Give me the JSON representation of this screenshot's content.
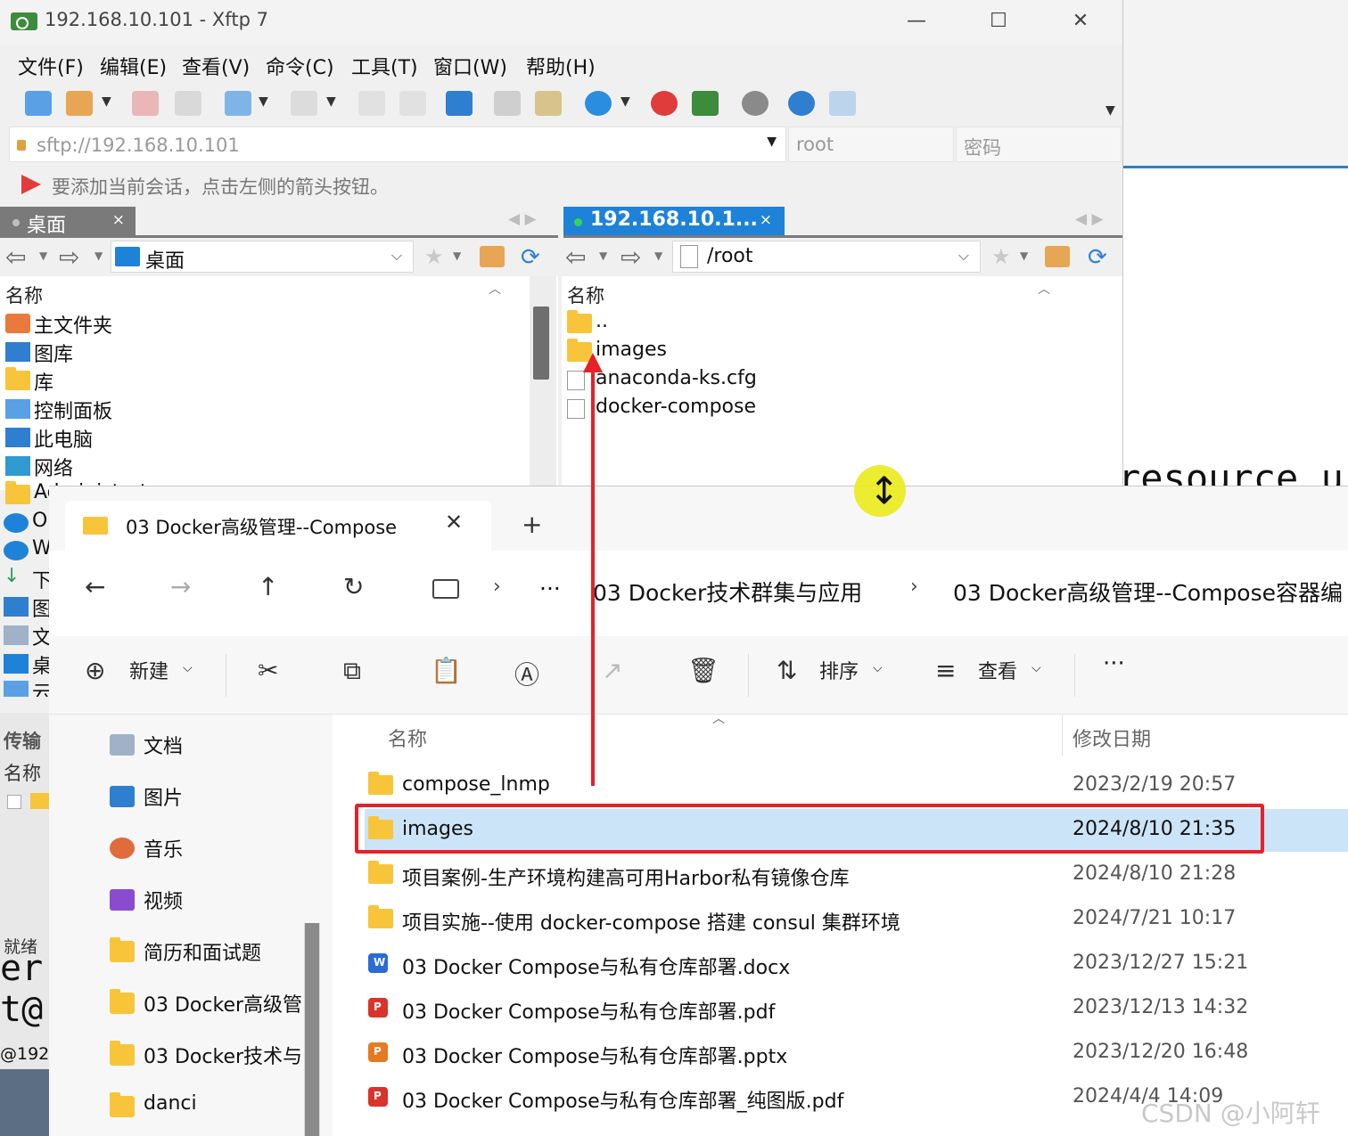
{
  "terminal": {
    "text": "resource u"
  },
  "xftp": {
    "title": "192.168.10.101 - Xftp 7",
    "window_controls": {
      "minimize": "—",
      "maximize": "☐",
      "close": "✕"
    },
    "menu": [
      "文件(F)",
      "编辑(E)",
      "查看(V)",
      "命令(C)",
      "工具(T)",
      "窗口(W)",
      "帮助(H)"
    ],
    "address": {
      "value": "sftp://192.168.10.101",
      "user_placeholder": "root",
      "password_placeholder": "密码"
    },
    "hint": "要添加当前会话，点击左侧的箭头按钮。",
    "local": {
      "tab_label": "桌面",
      "path": "桌面",
      "column_name": "名称",
      "items": [
        "主文件夹",
        "图库",
        "库",
        "控制面板",
        "此电脑",
        "网络",
        "Administrator"
      ],
      "partial_items": [
        "O",
        "W",
        "下",
        "图",
        "文",
        "桌",
        "云"
      ]
    },
    "remote": {
      "tab_label": "192.168.10.1...",
      "path": "/root",
      "column_name": "名称",
      "items": [
        "..",
        "images",
        "anaconda-ks.cfg",
        "docker-compose"
      ]
    },
    "bottom": {
      "transfer_label": "传输",
      "name_label": "名称",
      "status": "就绪",
      "term1": "er",
      "term2": "t@",
      "ip": "@192."
    },
    "tab_close": "×"
  },
  "explorer": {
    "tab_title": "03 Docker高级管理--Compose",
    "tab_close": "✕",
    "new_tab": "+",
    "nav": {
      "back": "←",
      "forward": "→",
      "up": "↑",
      "refresh": "↻"
    },
    "breadcrumb": {
      "more": "···",
      "crumb1": "03 Docker技术群集与应用",
      "crumb2": "03 Docker高级管理--Compose容器编",
      "sep": "›"
    },
    "commands": {
      "new": "新建",
      "sort": "排序",
      "view": "查看",
      "more": "···"
    },
    "sidebar": [
      {
        "label": "文档",
        "pinned": true
      },
      {
        "label": "图片",
        "pinned": true
      },
      {
        "label": "音乐",
        "pinned": true
      },
      {
        "label": "视频",
        "pinned": true
      },
      {
        "label": "简历和面试题",
        "pinned": false
      },
      {
        "label": "03 Docker高级管",
        "pinned": false
      },
      {
        "label": "03 Docker技术与",
        "pinned": false
      },
      {
        "label": "danci",
        "pinned": false
      }
    ],
    "columns": {
      "name": "名称",
      "date": "修改日期"
    },
    "files": [
      {
        "name": "compose_lnmp",
        "date": "2023/2/19 20:57",
        "type": "folder"
      },
      {
        "name": "images",
        "date": "2024/8/10 21:35",
        "type": "folder",
        "selected": true
      },
      {
        "name": "项目案例-生产环境构建高可用Harbor私有镜像仓库",
        "date": "2024/8/10 21:28",
        "type": "folder"
      },
      {
        "name": "项目实施--使用 docker-compose 搭建 consul 集群环境",
        "date": "2024/7/21 10:17",
        "type": "folder"
      },
      {
        "name": "03 Docker Compose与私有仓库部署.docx",
        "date": "2023/12/27 15:21",
        "type": "docx"
      },
      {
        "name": "03 Docker Compose与私有仓库部署.pdf",
        "date": "2023/12/13 14:32",
        "type": "pdf"
      },
      {
        "name": "03 Docker Compose与私有仓库部署.pptx",
        "date": "2023/12/20 16:48",
        "type": "pptx"
      },
      {
        "name": "03 Docker Compose与私有仓库部署_纯图版.pdf",
        "date": "2024/4/4 14:09",
        "type": "pdf"
      }
    ]
  },
  "watermark": "CSDN @小阿轩yx",
  "colors": {
    "accent": "#1e82d8",
    "highlight": "#e5212a",
    "selection": "#cce4f7",
    "folder": "#f8c53a"
  }
}
